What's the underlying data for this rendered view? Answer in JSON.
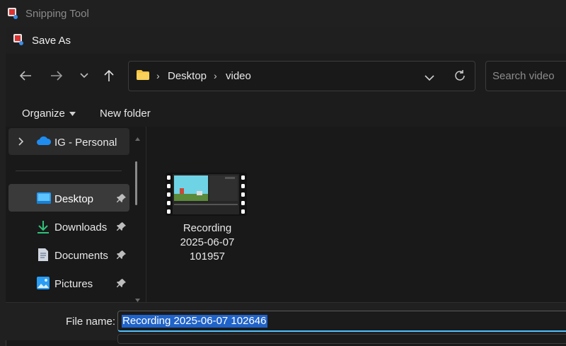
{
  "background_app": {
    "title": "Snipping Tool"
  },
  "dialog": {
    "title": "Save As"
  },
  "nav": {
    "breadcrumb": [
      "Desktop",
      "video"
    ],
    "search_placeholder": "Search video"
  },
  "toolbar": {
    "organize_label": "Organize",
    "new_folder_label": "New folder"
  },
  "sidebar": {
    "cloud_item": "IG - Personal",
    "items": [
      {
        "label": "Desktop",
        "icon": "desktop-icon",
        "pinned": true,
        "selected": true
      },
      {
        "label": "Downloads",
        "icon": "download-icon",
        "pinned": true
      },
      {
        "label": "Documents",
        "icon": "document-icon",
        "pinned": true
      },
      {
        "label": "Pictures",
        "icon": "pictures-icon",
        "pinned": true
      }
    ]
  },
  "files": [
    {
      "name_line1": "Recording",
      "name_line2": "2025-06-07",
      "name_line3": "101957",
      "icon": "video-file-icon"
    }
  ],
  "save": {
    "file_name_label": "File name:",
    "file_name_value": "Recording 2025-06-07 102646"
  },
  "colors": {
    "accent": "#4cc2ff",
    "selection": "#2063c9",
    "folder": "#f5c542"
  }
}
